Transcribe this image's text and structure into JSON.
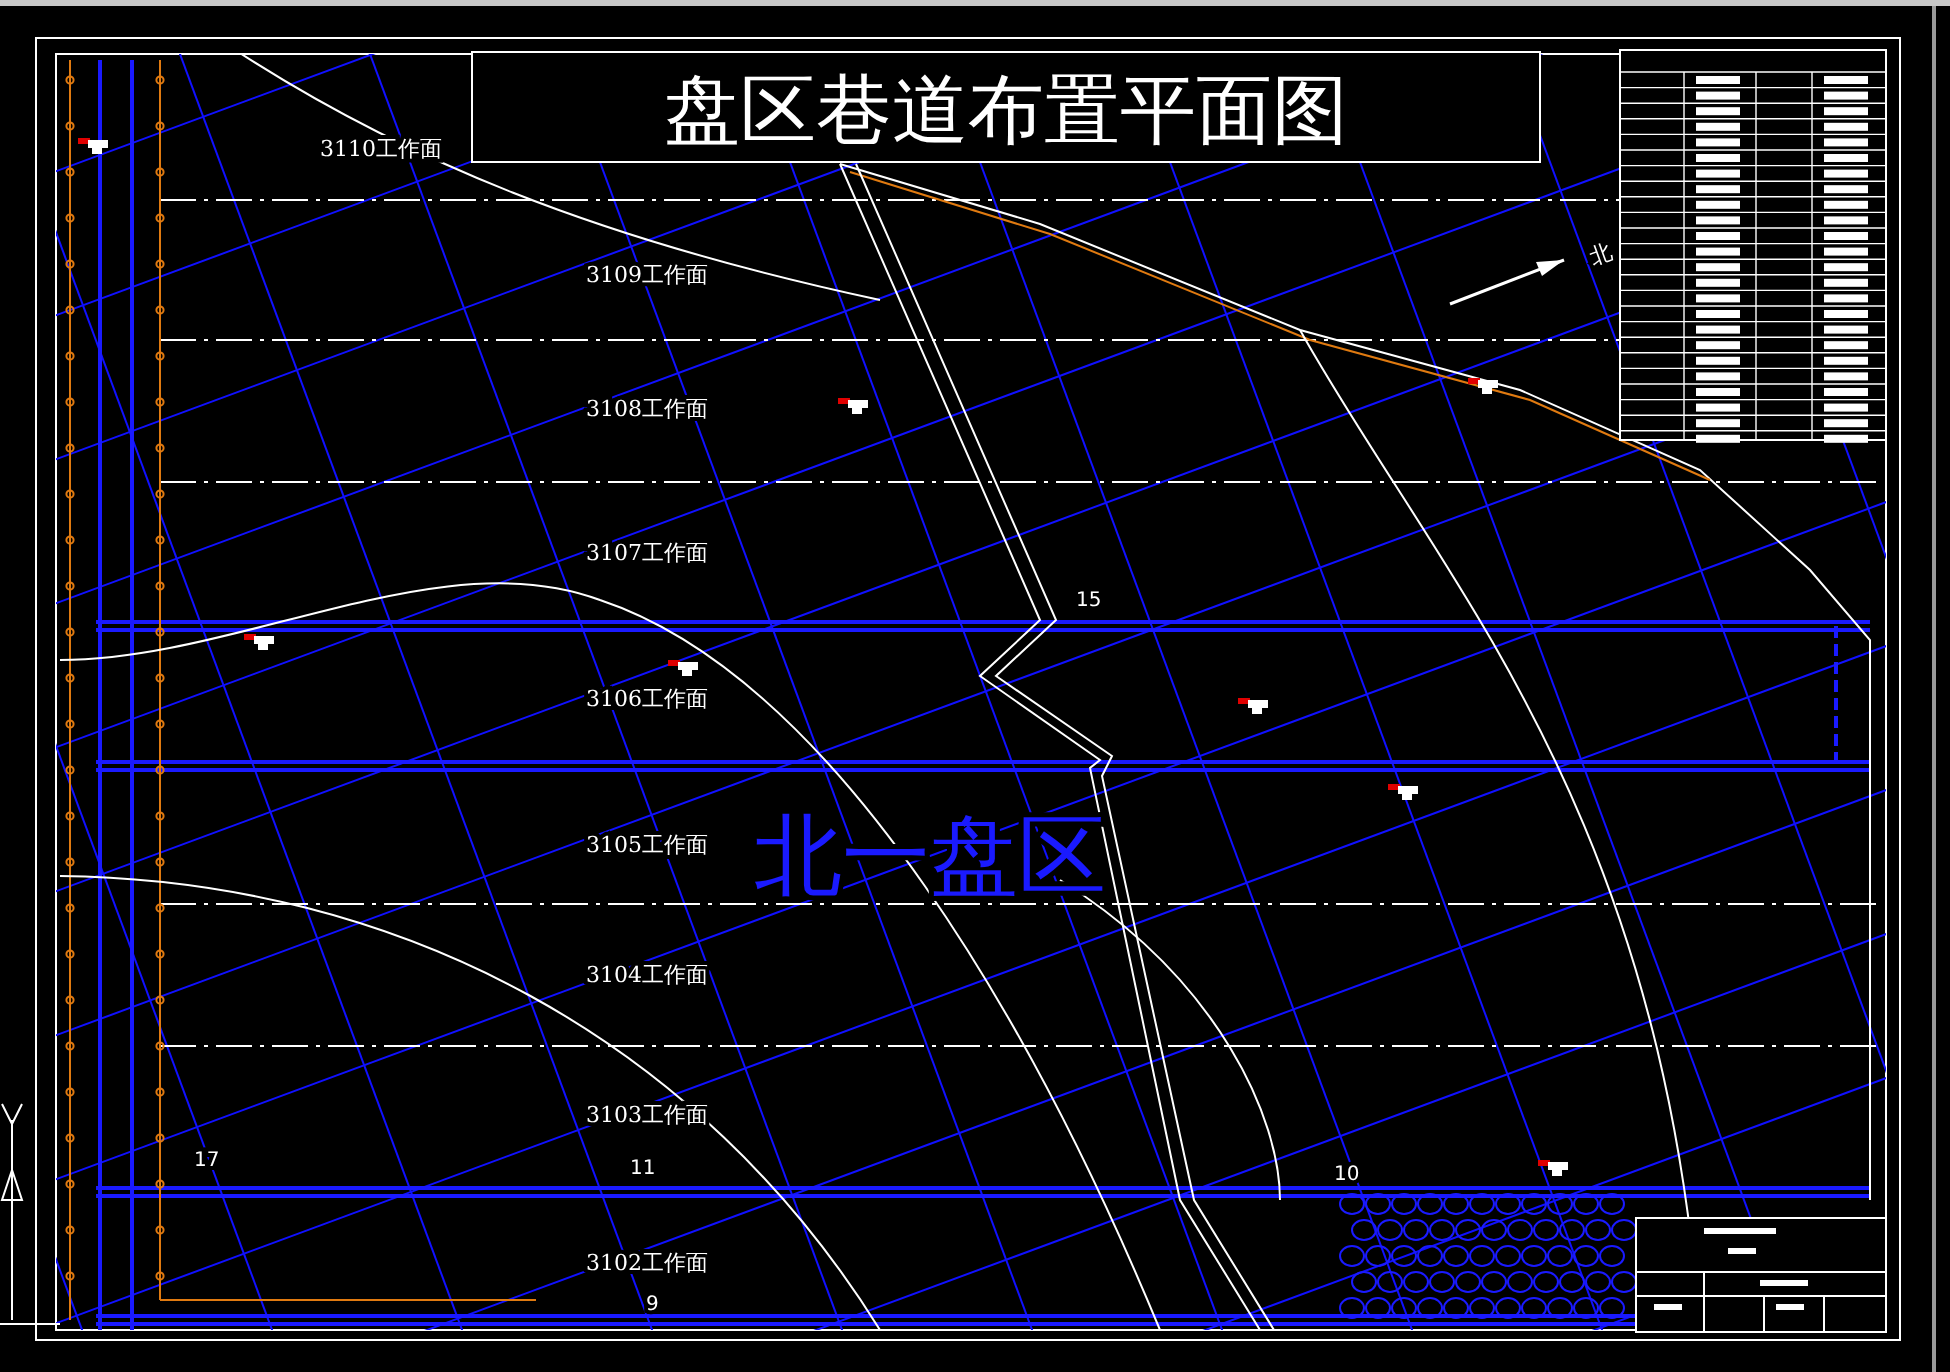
{
  "drawing_title": "盘区巷道布置平面图",
  "panel_label": "北一盘区",
  "north_label": "北",
  "workfaces": [
    {
      "label": "3110工作面"
    },
    {
      "label": "3109工作面"
    },
    {
      "label": "3108工作面"
    },
    {
      "label": "3107工作面"
    },
    {
      "label": "3106工作面"
    },
    {
      "label": "3105工作面"
    },
    {
      "label": "3104工作面"
    },
    {
      "label": "3103工作面"
    },
    {
      "label": "3102工作面"
    }
  ],
  "point_numbers": [
    {
      "label": "15"
    },
    {
      "label": "17"
    },
    {
      "label": "11"
    },
    {
      "label": "10"
    },
    {
      "label": "9"
    }
  ]
}
